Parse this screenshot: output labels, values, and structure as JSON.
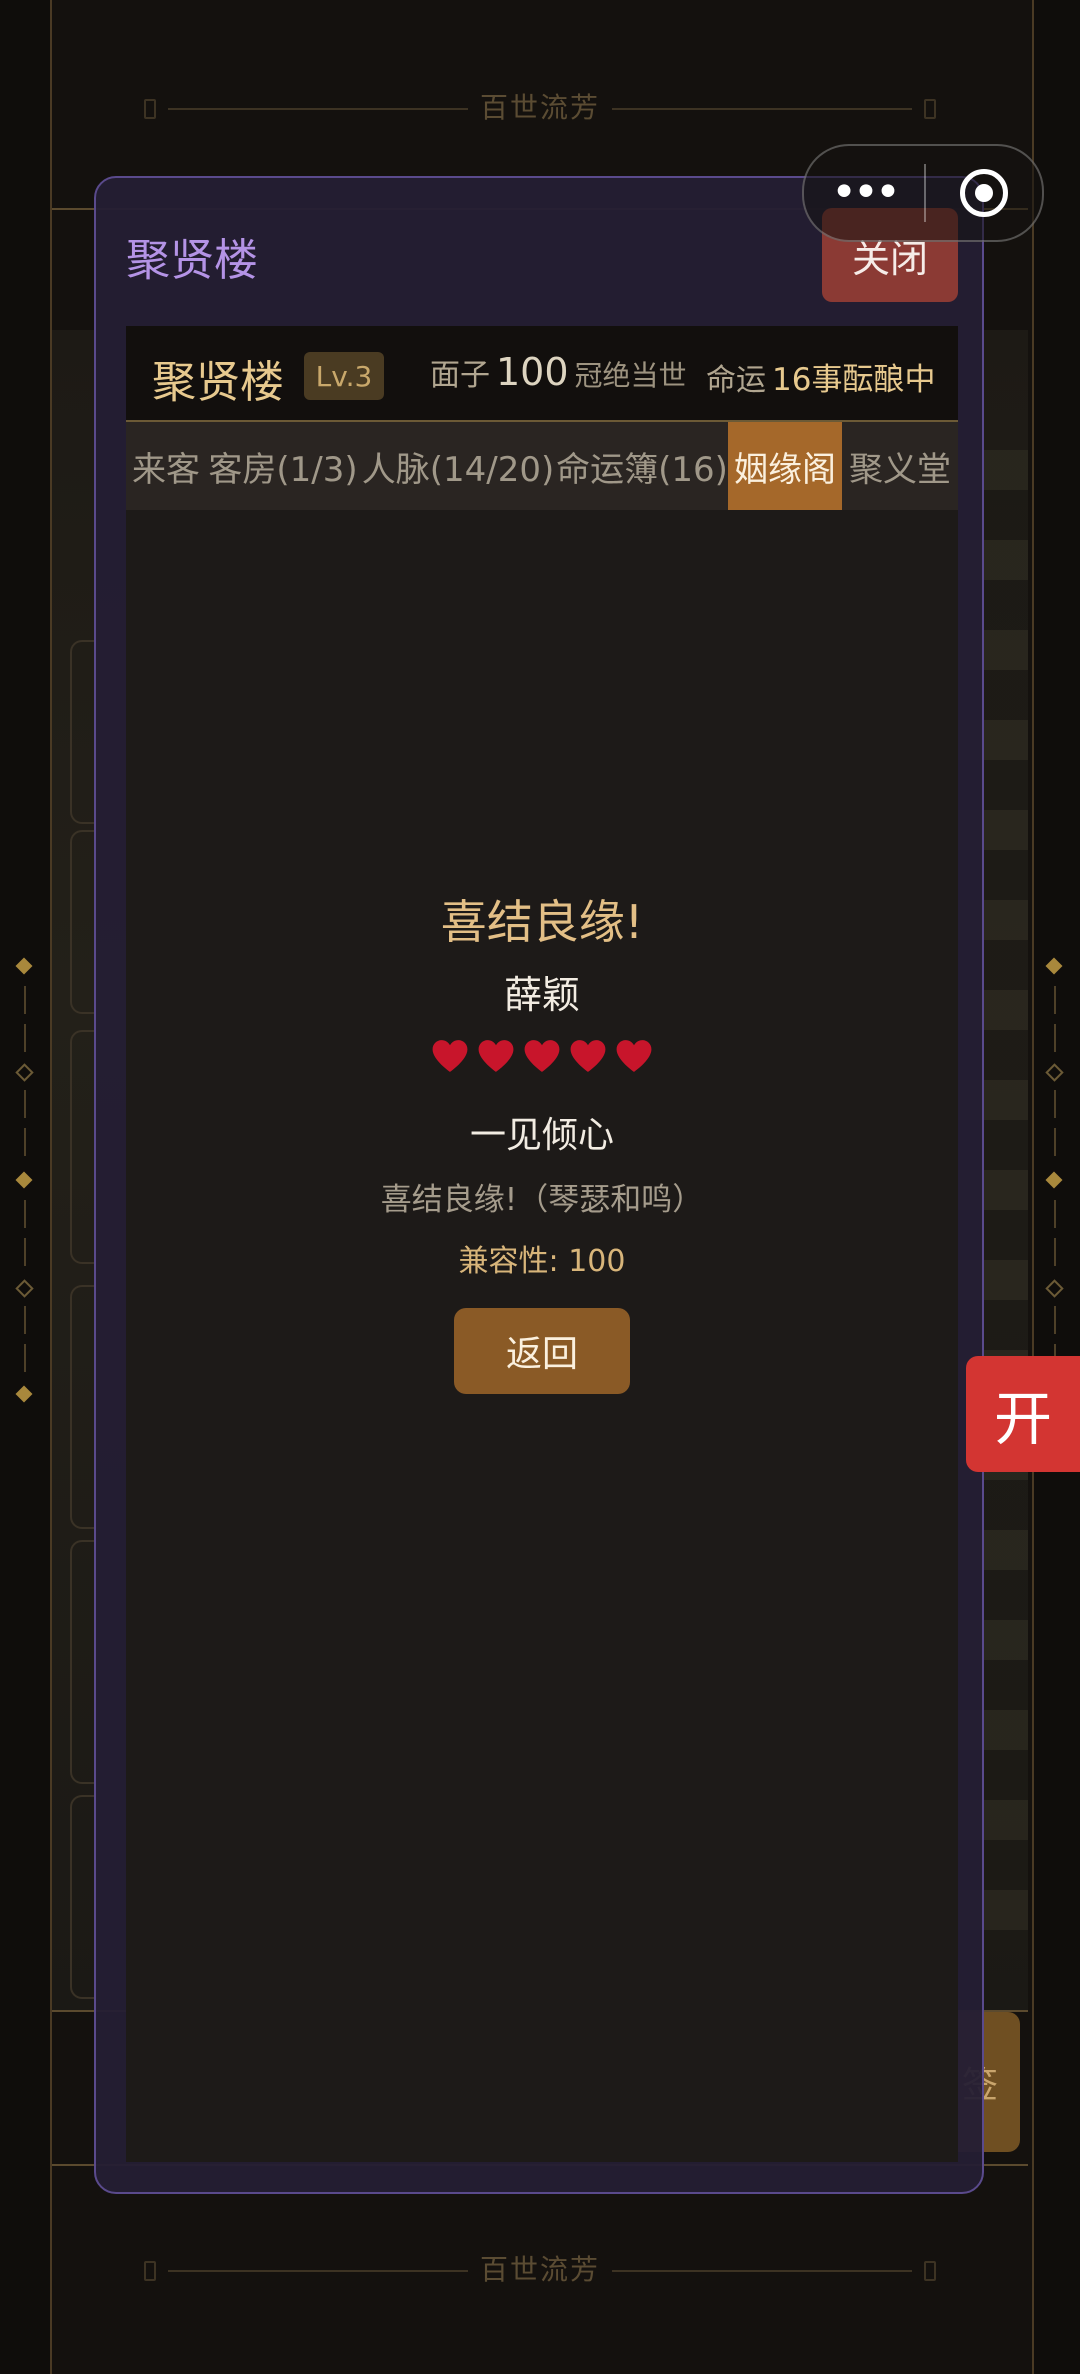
{
  "background": {
    "banner_text": "百世流芳",
    "side_button_text": "签"
  },
  "capsule": {
    "more_label": "•••",
    "target_label": ""
  },
  "float_button": {
    "label": "开"
  },
  "modal": {
    "title": "聚贤楼",
    "close_label": "关闭",
    "header": {
      "name": "聚贤楼",
      "level": "Lv.3",
      "face_label": "面子",
      "face_value": "100",
      "face_rank": "冠绝当世",
      "fate_label": "命运",
      "fate_value": "16事酝酿中"
    },
    "tabs": [
      {
        "label": "来客",
        "active": false
      },
      {
        "label": "客房(1/3)",
        "active": false
      },
      {
        "label": "人脉(14/20)",
        "active": false
      },
      {
        "label": "命运簿(16)",
        "active": false
      },
      {
        "label": "姻缘阁",
        "active": true
      },
      {
        "label": "聚义堂",
        "active": false
      }
    ],
    "result": {
      "title": "喜结良缘!",
      "name": "薛颖",
      "hearts": 5,
      "heart_color": "#c8152b",
      "level_text": "一见倾心",
      "description": "喜结良缘!（琴瑟和鸣）",
      "compatibility": "兼容性: 100",
      "back_label": "返回"
    }
  }
}
